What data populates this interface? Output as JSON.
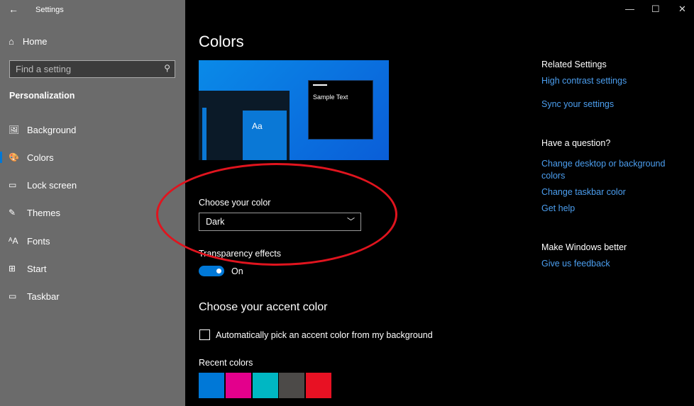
{
  "window": {
    "title": "Settings",
    "back": "←",
    "minimize": "—",
    "maximize": "☐",
    "close": "✕"
  },
  "sidebar": {
    "home": "Home",
    "search_placeholder": "Find a setting",
    "section": "Personalization",
    "items": [
      {
        "label": "Background",
        "icon": "🖼"
      },
      {
        "label": "Colors",
        "icon": "🎨"
      },
      {
        "label": "Lock screen",
        "icon": "▭"
      },
      {
        "label": "Themes",
        "icon": "✎"
      },
      {
        "label": "Fonts",
        "icon": "ᴬA"
      },
      {
        "label": "Start",
        "icon": "⊞"
      },
      {
        "label": "Taskbar",
        "icon": "▭"
      }
    ]
  },
  "main": {
    "title": "Colors",
    "preview": {
      "sample_text": "Sample Text",
      "tile_text": "Aa"
    },
    "choose_color_label": "Choose your color",
    "choose_color_value": "Dark",
    "transparency_label": "Transparency effects",
    "transparency_state": "On",
    "accent_heading": "Choose your accent color",
    "auto_accent_label": "Automatically pick an accent color from my background",
    "recent_colors_label": "Recent colors",
    "recent_colors": [
      "#0078d7",
      "#e3008c",
      "#00b7c3",
      "#4c4a48",
      "#e81123"
    ]
  },
  "related": {
    "heading": "Related Settings",
    "high_contrast": "High contrast settings",
    "sync": "Sync your settings",
    "question_heading": "Have a question?",
    "change_bg_1": "Change desktop or background",
    "change_bg_2": "colors",
    "change_taskbar": "Change taskbar color",
    "get_help": "Get help",
    "better_heading": "Make Windows better",
    "feedback": "Give us feedback"
  }
}
